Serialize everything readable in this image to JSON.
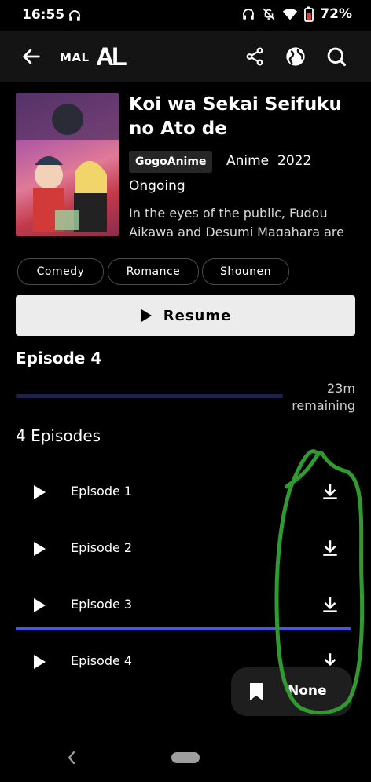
{
  "status_bar": {
    "time": "16:55",
    "battery": "72%"
  },
  "app_bar": {
    "mal_logo": "MAL",
    "al_logo": "AL"
  },
  "anime": {
    "title": "Koi wa Sekai Seifuku no Ato de",
    "source": "GogoAnime",
    "type": "Anime",
    "year": "2022",
    "status": "Ongoing",
    "description": "In the eyes of the public, Fudou Aikawa and Desumi Magahara are"
  },
  "genres": [
    "Comedy",
    "Romance",
    "Shounen"
  ],
  "resume": {
    "label": "Resume",
    "current_episode": "Episode 4",
    "remaining_line1": "23m",
    "remaining_line2": "remaining",
    "progress": 0.0
  },
  "episode_list": {
    "count_label": "4 Episodes",
    "episodes": [
      {
        "label": "Episode 1"
      },
      {
        "label": "Episode 2"
      },
      {
        "label": "Episode 3",
        "watched_progress": 1.0
      },
      {
        "label": "Episode 4"
      }
    ]
  },
  "fab": {
    "label": "None"
  },
  "colors": {
    "accent": "#4a53e8",
    "annotation": "#2f9a2f"
  }
}
